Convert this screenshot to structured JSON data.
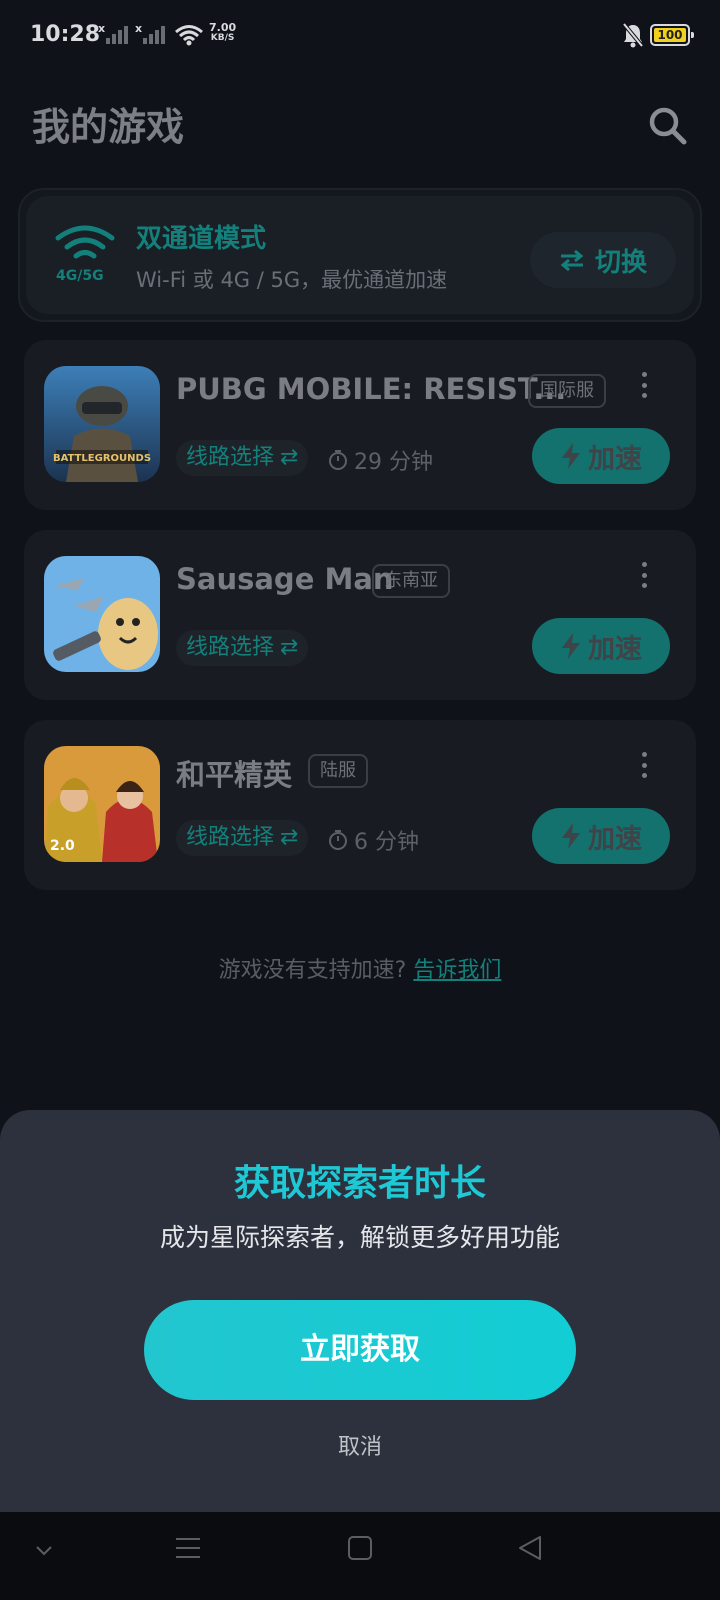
{
  "status_bar": {
    "time": "10:28",
    "net_speed_value": "7.00",
    "net_speed_unit": "KB/S",
    "battery": "100",
    "battery_color": "#f0d21e"
  },
  "header": {
    "title": "我的游戏",
    "search_icon": "search-icon"
  },
  "mode_card": {
    "band_label": "4G/5G",
    "title": "双通道模式",
    "description": "Wi-Fi 或 4G / 5G，最优通道加速",
    "switch_label": "切换",
    "accent": "#13807c"
  },
  "games": [
    {
      "name": "PUBG MOBILE: RESIST...",
      "region": "国际服",
      "route_label": "线路选择",
      "play_time": "29 分钟",
      "speed_label": "加速"
    },
    {
      "name": "Sausage Man",
      "region": "东南亚",
      "route_label": "线路选择",
      "play_time": "",
      "speed_label": "加速"
    },
    {
      "name": "和平精英",
      "region": "陆服",
      "route_label": "线路选择",
      "play_time": "6 分钟",
      "speed_label": "加速"
    }
  ],
  "feedback": {
    "question": "游戏没有支持加速?",
    "link": "告诉我们"
  },
  "sheet": {
    "title": "获取探索者时长",
    "subtitle": "成为星际探索者，解锁更多好用功能",
    "cta": "立即获取",
    "cancel": "取消",
    "accent": "#1ec8d4"
  },
  "nav_bar": {
    "items": [
      "chevron-down-icon",
      "menu-icon",
      "home-square-icon",
      "back-triangle-icon"
    ]
  }
}
